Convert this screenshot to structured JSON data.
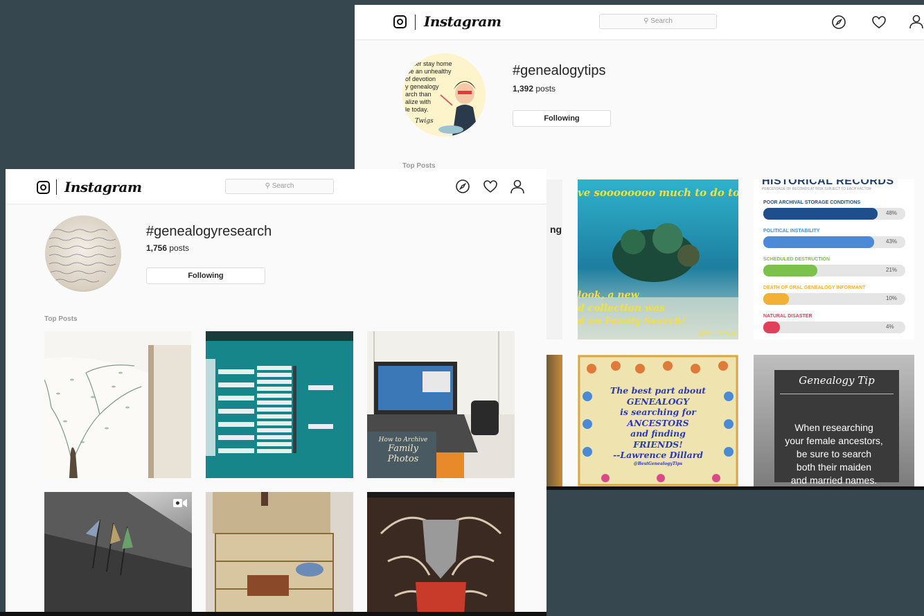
{
  "app_name": "Instagram",
  "back_window": {
    "hashtag": "#genealogytips",
    "posts_count": "1,392",
    "posts_label": "posts",
    "follow_label": "Following",
    "search_placeholder": "Search",
    "section_label": "Top Posts",
    "avatar_text": [
      "rather stay home",
      "rse an unhealthy",
      "of devotion",
      "y genealogy",
      "arch than",
      "alize with",
      "le today.",
      "Twigs"
    ],
    "tiles": {
      "t1_text": "ng",
      "t2_lines": [
        "ve soooooooo much to do to",
        "look, a new",
        "d collection was",
        "d on Family Search!",
        "@BestGeneal"
      ],
      "records": {
        "title": "HISTORICAL RECORDS",
        "subtitle": "PERCENTAGE OF RECORDS AT RISK SUBJECT TO EACH FACTOR",
        "rows": [
          {
            "label": "POOR ARCHIVAL STORAGE CONDITIONS",
            "value": "48%",
            "pct": 0.48,
            "color": "#1f4e8c"
          },
          {
            "label": "POLITICAL INSTABILITY",
            "value": "43%",
            "pct": 0.43,
            "color": "#4a8ad6"
          },
          {
            "label": "SCHEDULED DESTRUCTION",
            "value": "21%",
            "pct": 0.21,
            "color": "#7cc14a"
          },
          {
            "label": "DEATH OF ORAL GENEALOGY INFORMANT",
            "value": "10%",
            "pct": 0.1,
            "color": "#f2b134"
          },
          {
            "label": "NATURAL DISASTER",
            "value": "4%",
            "pct": 0.04,
            "color": "#e0405a"
          }
        ]
      },
      "quote_lines": [
        "The best part about",
        "GENEALOGY",
        "is searching for",
        "ANCESTORS",
        "and finding",
        "FRIENDS!",
        "--Lawrence Dillard",
        "@BestGenealogyTips"
      ],
      "tip": {
        "title": "Genealogy Tip",
        "lines": [
          "When researching",
          "your female ancestors,",
          "be sure to search",
          "both their maiden",
          "and married names."
        ]
      }
    }
  },
  "front_window": {
    "hashtag": "#genealogyresearch",
    "posts_count": "1,756",
    "posts_label": "posts",
    "follow_label": "Following",
    "search_placeholder": "Search",
    "section_label": "Top Posts",
    "book_title": [
      "How to Archive",
      "Family Photos"
    ]
  },
  "colors": {
    "backdrop": "#37474f",
    "teal": "#17868a",
    "ocean": "#2a9fb8"
  }
}
